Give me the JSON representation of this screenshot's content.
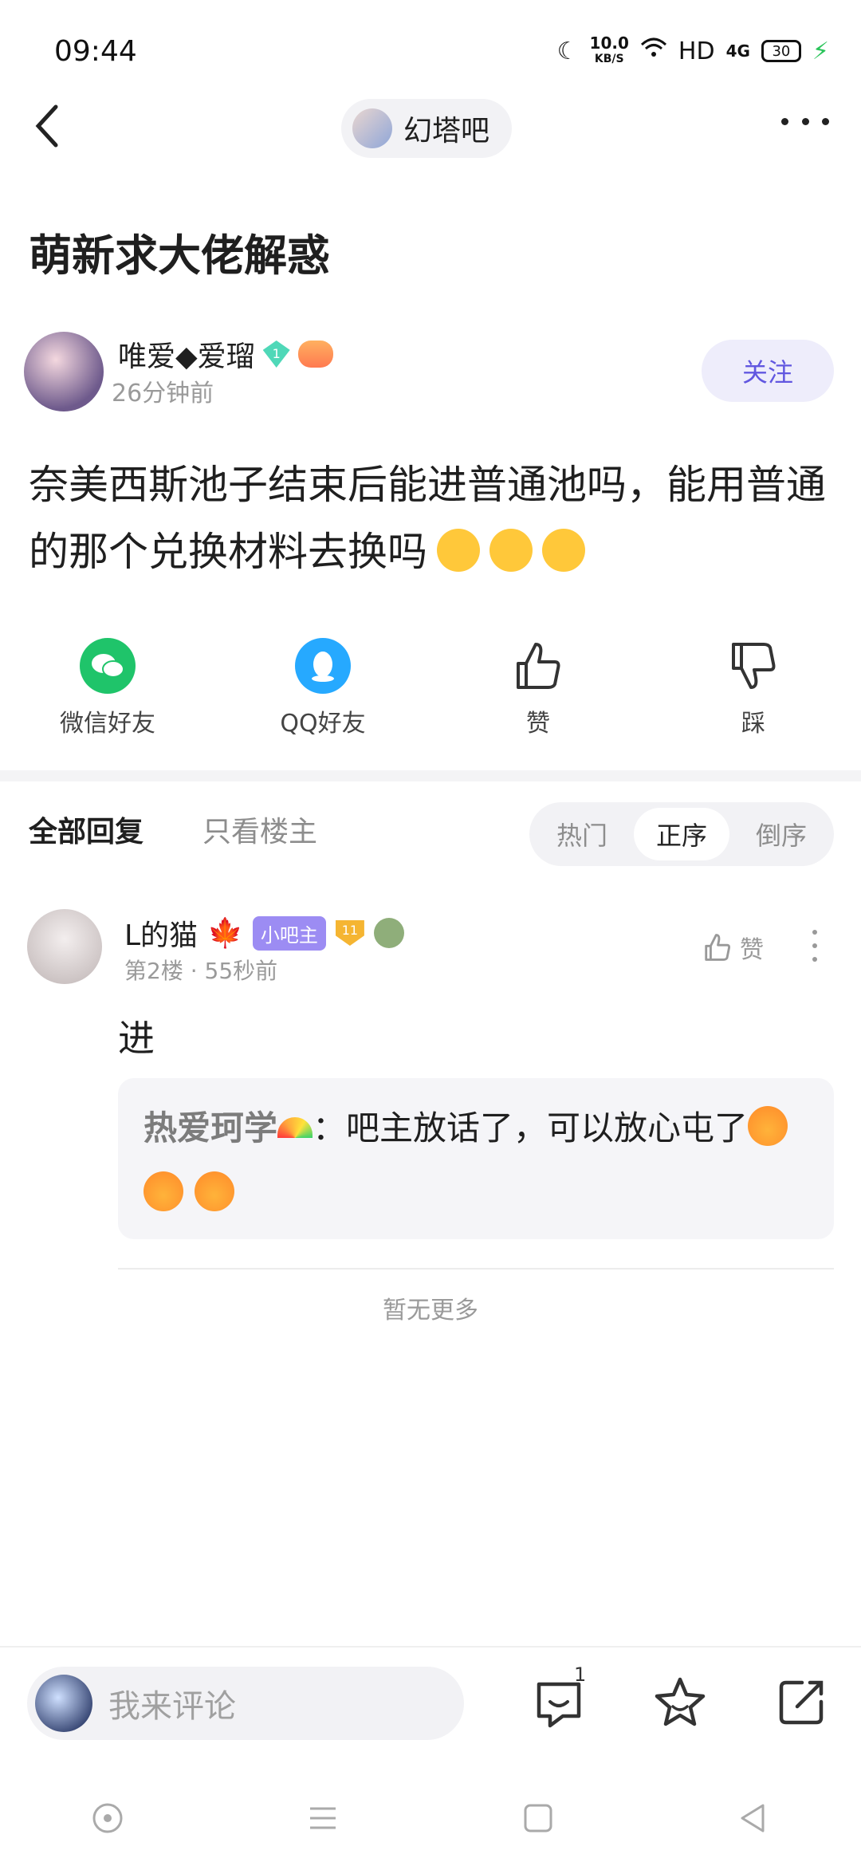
{
  "status_bar": {
    "time": "09:44",
    "net_speed_value": "10.0",
    "net_speed_unit": "KB/S",
    "hd": "HD",
    "network": "4G",
    "battery": "30"
  },
  "header": {
    "forum_name": "幻塔吧"
  },
  "post": {
    "title": "萌新求大佬解惑",
    "author": "唯爱◆爱瑠",
    "author_level": "1",
    "time": "26分钟前",
    "follow_label": "关注",
    "body": "奈美西斯池子结束后能进普通池吗，能用普通的那个兑换材料去换吗"
  },
  "share": {
    "wechat": "微信好友",
    "qq": "QQ好友",
    "like": "赞",
    "dislike": "踩"
  },
  "filters": {
    "all_replies": "全部回复",
    "op_only": "只看楼主",
    "sort": [
      "热门",
      "正序",
      "倒序"
    ],
    "active_sort": "正序"
  },
  "reply": {
    "author": "L的猫",
    "role_badge": "小吧主",
    "level": "11",
    "floor": "第2楼",
    "time": "55秒前",
    "like_label": "赞",
    "text": "进",
    "sub_reply": {
      "author": "热爱珂学",
      "text": "：吧主放话了，可以放心屯了"
    }
  },
  "no_more": "暂无更多",
  "bottom": {
    "comment_placeholder": "我来评论",
    "comment_count": "1"
  },
  "colors": {
    "accent": "#6157e0",
    "wechat": "#1fc46a",
    "qq": "#26a9ff"
  }
}
